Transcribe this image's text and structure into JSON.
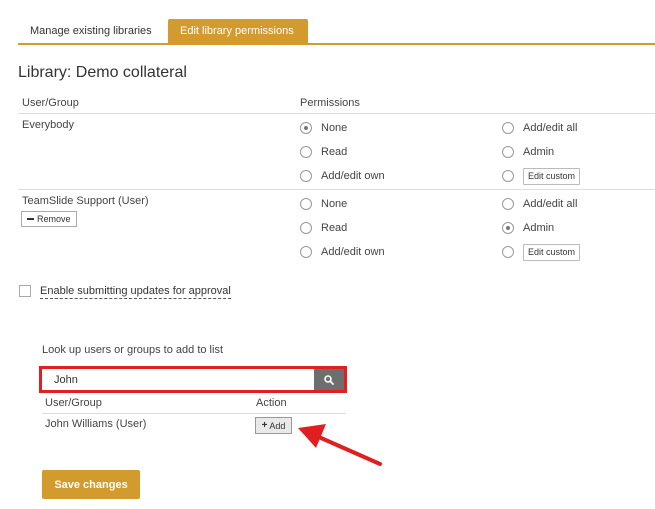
{
  "tabs": [
    {
      "label": "Manage existing libraries",
      "active": false
    },
    {
      "label": "Edit library permissions",
      "active": true
    }
  ],
  "library_title": "Library: Demo collateral",
  "table": {
    "col_user": "User/Group",
    "col_permissions": "Permissions",
    "rows": [
      {
        "name": "Everybody",
        "options": {
          "none": "None",
          "read": "Read",
          "add_edit_own": "Add/edit own",
          "add_edit_all": "Add/edit all",
          "admin": "Admin"
        },
        "selected": "None",
        "custom_button": "Edit custom"
      },
      {
        "name": "TeamSlide Support (User)",
        "remove_label": "Remove",
        "options": {
          "none": "None",
          "read": "Read",
          "add_edit_own": "Add/edit own",
          "add_edit_all": "Add/edit all",
          "admin": "Admin"
        },
        "selected": "Admin",
        "custom_button": "Edit custom"
      }
    ]
  },
  "approval_checkbox": {
    "label": "Enable submitting updates for approval",
    "checked": false
  },
  "lookup": {
    "label": "Look up users or groups to add to list",
    "input_value": "John",
    "results_col_user": "User/Group",
    "results_col_action": "Action",
    "results": [
      {
        "name": "John Williams (User)",
        "action_label": "Add"
      }
    ]
  },
  "save_label": "Save changes",
  "colors": {
    "accent": "#d39a2e",
    "highlight": "#e02020",
    "search_button": "#6e6e6e"
  }
}
